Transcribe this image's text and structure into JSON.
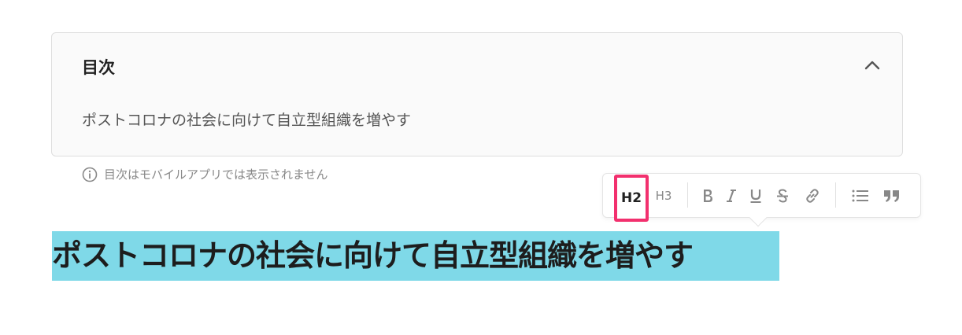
{
  "toc": {
    "title": "目次",
    "items": [
      {
        "label": "ポストコロナの社会に向けて自立型組織を増やす"
      }
    ]
  },
  "notice": {
    "text": "目次はモバイルアプリでは表示されません"
  },
  "toolbar": {
    "h2_label": "H2",
    "h3_label": "H3",
    "icons": [
      "bold-icon",
      "italic-icon",
      "underline-icon",
      "strikethrough-icon",
      "link-icon",
      "bulleted-list-icon",
      "quote-icon"
    ],
    "highlight_color": "#f2306e"
  },
  "editor": {
    "heading_text": "ポストコロナの社会に向けて自立型組織を増やす",
    "selection_color": "#7fd9e8"
  }
}
